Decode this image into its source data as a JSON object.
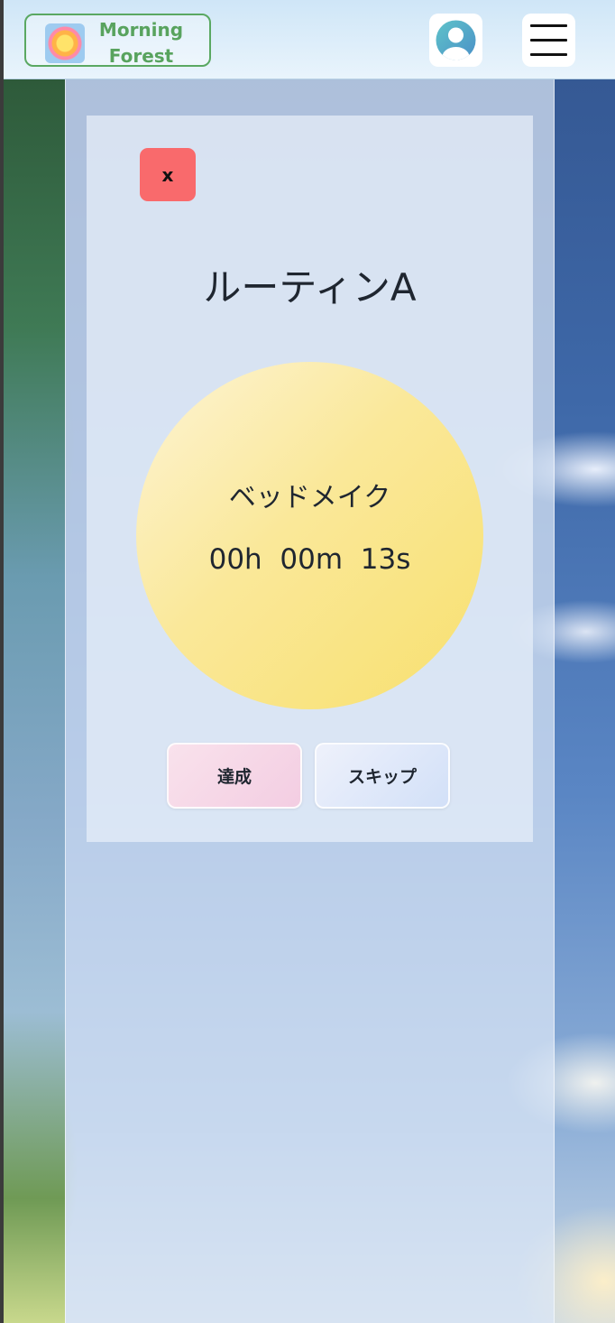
{
  "header": {
    "logo_icon": "sun-logo-icon",
    "logo_text_line1": "Morning",
    "logo_text_line2": "Forest",
    "user_icon": "user-avatar-icon",
    "menu_icon": "hamburger-menu-icon"
  },
  "routine": {
    "close_label": "x",
    "title": "ルーティンA",
    "task_name": "ベッドメイク",
    "timer": "00h  00m  13s",
    "done_label": "達成",
    "skip_label": "スキップ"
  },
  "colors": {
    "logo_green": "#58a35e",
    "close_red": "#f96a6c",
    "sun_yellow": "#f8e06e",
    "done_pink": "#f3cde2",
    "skip_blue": "#d2e0f8"
  }
}
